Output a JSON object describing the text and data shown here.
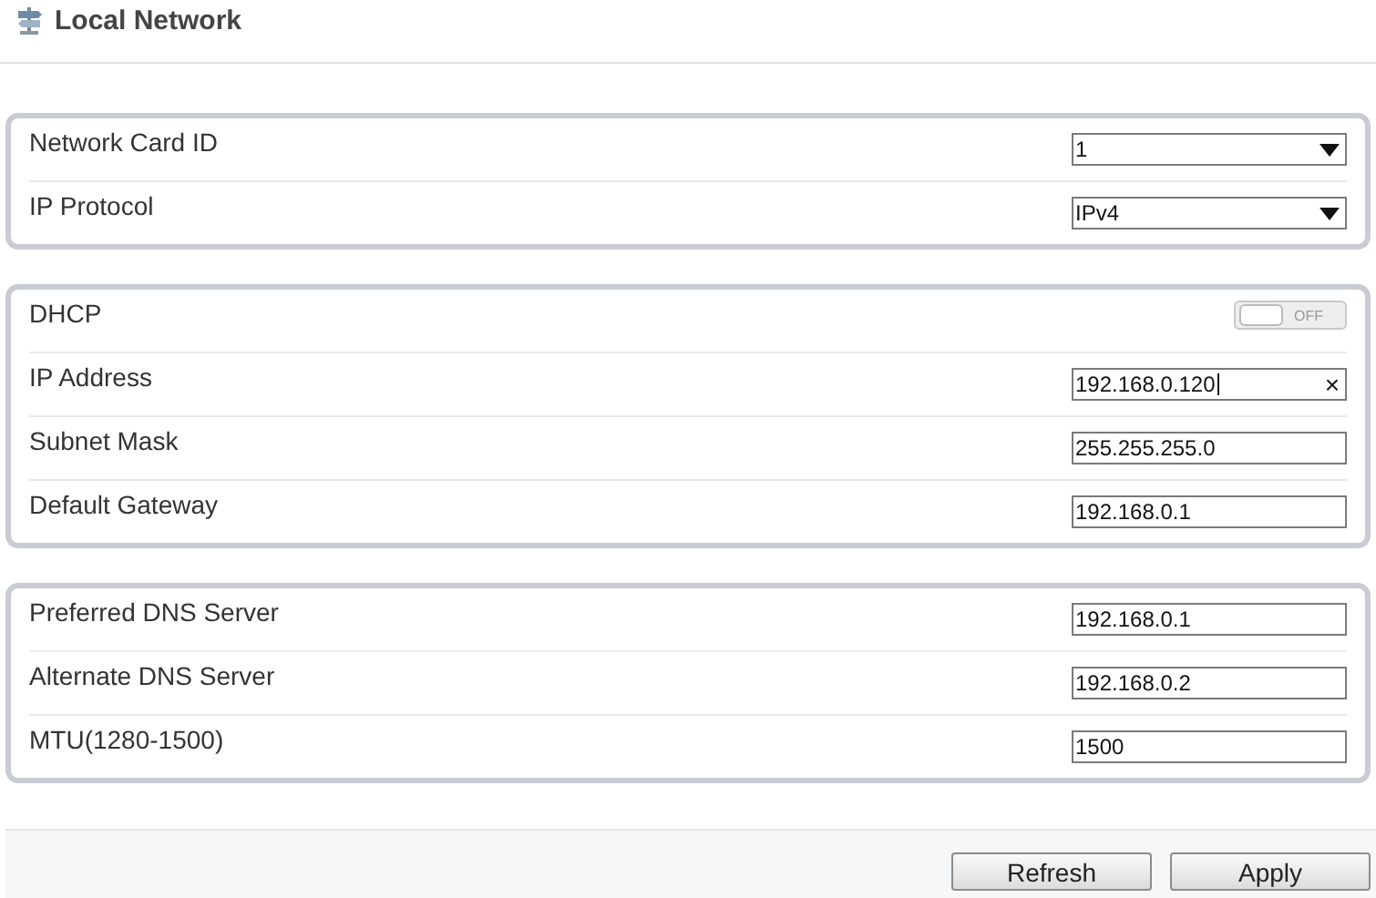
{
  "header": {
    "title": "Local Network"
  },
  "groups": [
    {
      "rows": [
        {
          "label": "Network Card ID",
          "kind": "select",
          "value": "1"
        },
        {
          "label": "IP Protocol",
          "kind": "select",
          "value": "IPv4"
        }
      ]
    },
    {
      "rows": [
        {
          "label": "DHCP",
          "kind": "toggle",
          "on": false,
          "state_text": "OFF"
        },
        {
          "label": "IP Address",
          "kind": "text",
          "value": "192.168.0.120",
          "clear": "×"
        },
        {
          "label": "Subnet Mask",
          "kind": "text",
          "value": "255.255.255.0"
        },
        {
          "label": "Default Gateway",
          "kind": "text",
          "value": "192.168.0.1"
        }
      ]
    },
    {
      "rows": [
        {
          "label": "Preferred DNS Server",
          "kind": "text",
          "value": "192.168.0.1"
        },
        {
          "label": "Alternate DNS Server",
          "kind": "text",
          "value": "192.168.0.2"
        },
        {
          "label": "MTU(1280-1500)",
          "kind": "text",
          "value": "1500"
        }
      ]
    }
  ],
  "buttons": [
    "Refresh",
    "Apply"
  ]
}
